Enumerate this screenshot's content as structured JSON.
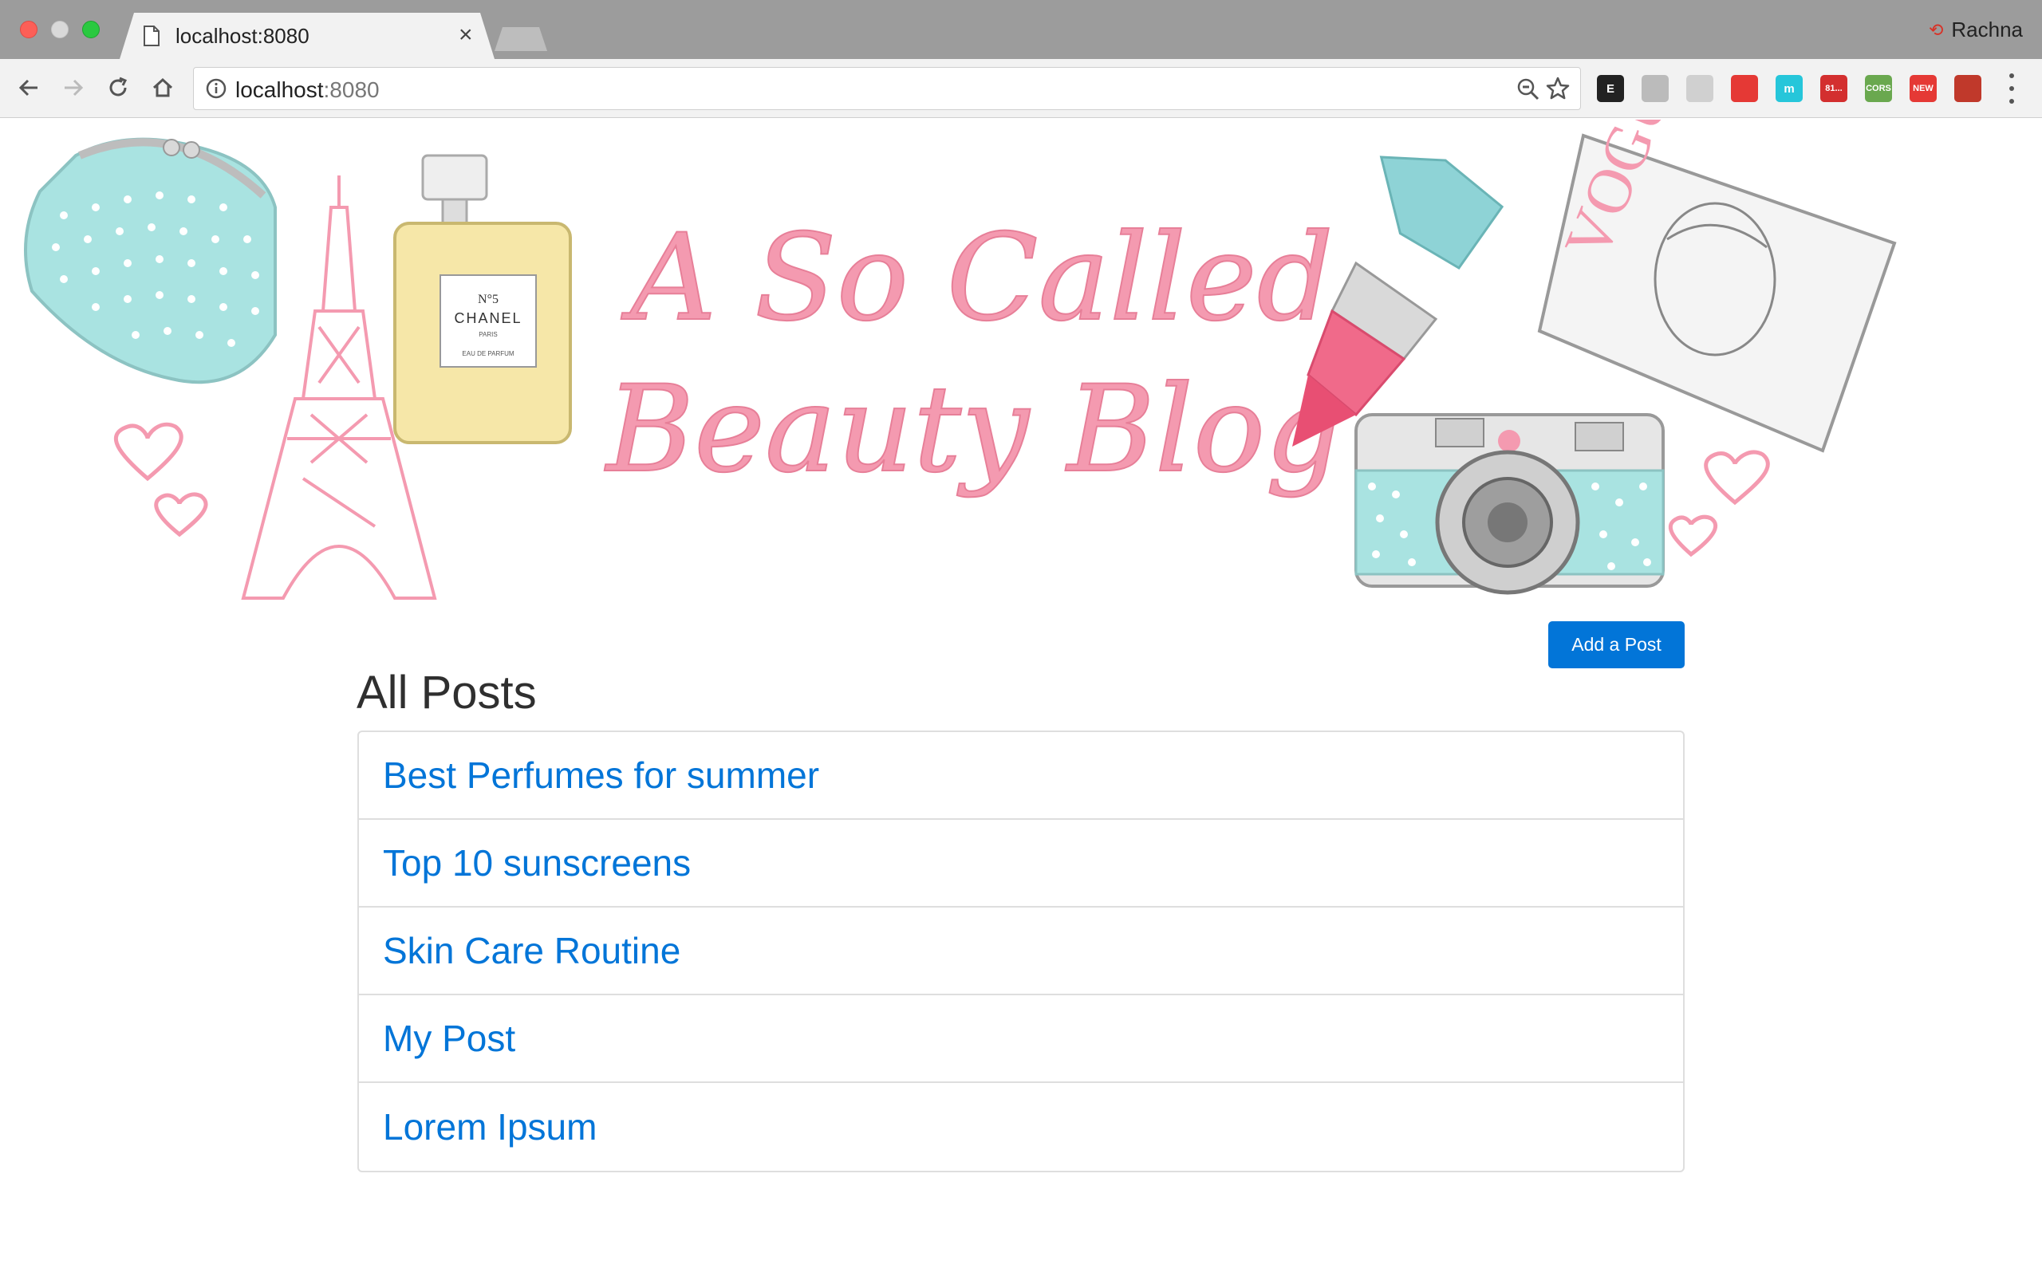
{
  "browser": {
    "tab": {
      "title": "localhost:8080",
      "close_glyph": "×"
    },
    "profile": {
      "name": "Rachna"
    },
    "address_bar": {
      "host": "localhost",
      "port": ":8080"
    },
    "extensions": [
      {
        "name": "evernote-extension-icon",
        "label": "E",
        "color": "#222222"
      },
      {
        "name": "drive-extension-icon",
        "label": "",
        "color": "#bbbbbb"
      },
      {
        "name": "feather-extension-icon",
        "label": "",
        "color": "#d0d0d0"
      },
      {
        "name": "opera-extension-icon",
        "label": "",
        "color": "#e53935"
      },
      {
        "name": "m-extension-icon",
        "label": "m",
        "color": "#26c6da"
      },
      {
        "name": "gmail-extension-icon",
        "label": "81...",
        "color": "#d32f2f"
      },
      {
        "name": "cors-extension-icon",
        "label": "CORS",
        "color": "#6aa84f"
      },
      {
        "name": "new-extension-icon",
        "label": "NEW",
        "color": "#e53935"
      },
      {
        "name": "puzzle-extension-icon",
        "label": "",
        "color": "#c0392b"
      }
    ]
  },
  "banner": {
    "title_line1": "A So Called",
    "title_line2": "Beauty Blog",
    "perfume_label": {
      "line1": "N°5",
      "line2": "CHANEL",
      "line3": "PARIS",
      "line4": "EAU DE PARFUM"
    },
    "magazine_title": "VOGUE"
  },
  "actions": {
    "add_post_label": "Add a Post"
  },
  "main": {
    "heading": "All Posts",
    "posts": [
      {
        "title": "Best Perfumes for summer"
      },
      {
        "title": "Top 10 sunscreens"
      },
      {
        "title": "Skin Care Routine"
      },
      {
        "title": "My Post"
      },
      {
        "title": "Lorem Ipsum"
      }
    ]
  },
  "colors": {
    "accent": "#0275d8",
    "banner_pink": "#f49ab0",
    "banner_teal": "#8fd6d6"
  }
}
